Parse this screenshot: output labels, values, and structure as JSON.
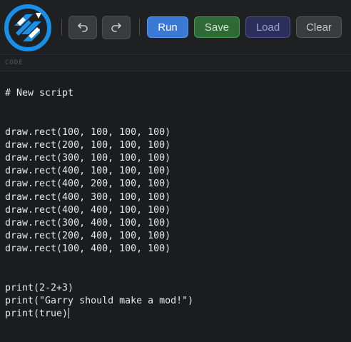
{
  "toolbar": {
    "undo_icon": "undo-arrow-icon",
    "redo_icon": "redo-arrow-icon",
    "run_label": "Run",
    "save_label": "Save",
    "load_label": "Load",
    "clear_label": "Clear"
  },
  "logo": {
    "icon": "brand-logo-icon",
    "color": "#1a8fe8"
  },
  "code_panel": {
    "header": "CODE",
    "lines": [
      "# New script",
      "",
      "",
      "draw.rect(100, 100, 100, 100)",
      "draw.rect(200, 100, 100, 100)",
      "draw.rect(300, 100, 100, 100)",
      "draw.rect(400, 100, 100, 100)",
      "draw.rect(400, 200, 100, 100)",
      "draw.rect(400, 300, 100, 100)",
      "draw.rect(400, 400, 100, 100)",
      "draw.rect(300, 400, 100, 100)",
      "draw.rect(200, 400, 100, 100)",
      "draw.rect(100, 400, 100, 100)",
      "",
      "",
      "print(2-2+3)",
      "print(\"Garry should make a mod!\")",
      "print(true)"
    ]
  },
  "colors": {
    "background": "#1b1c1e",
    "run": "#3a7ad6",
    "save": "#2f6a36",
    "load": "#2c2f5a",
    "clear": "#3a3b3f"
  }
}
